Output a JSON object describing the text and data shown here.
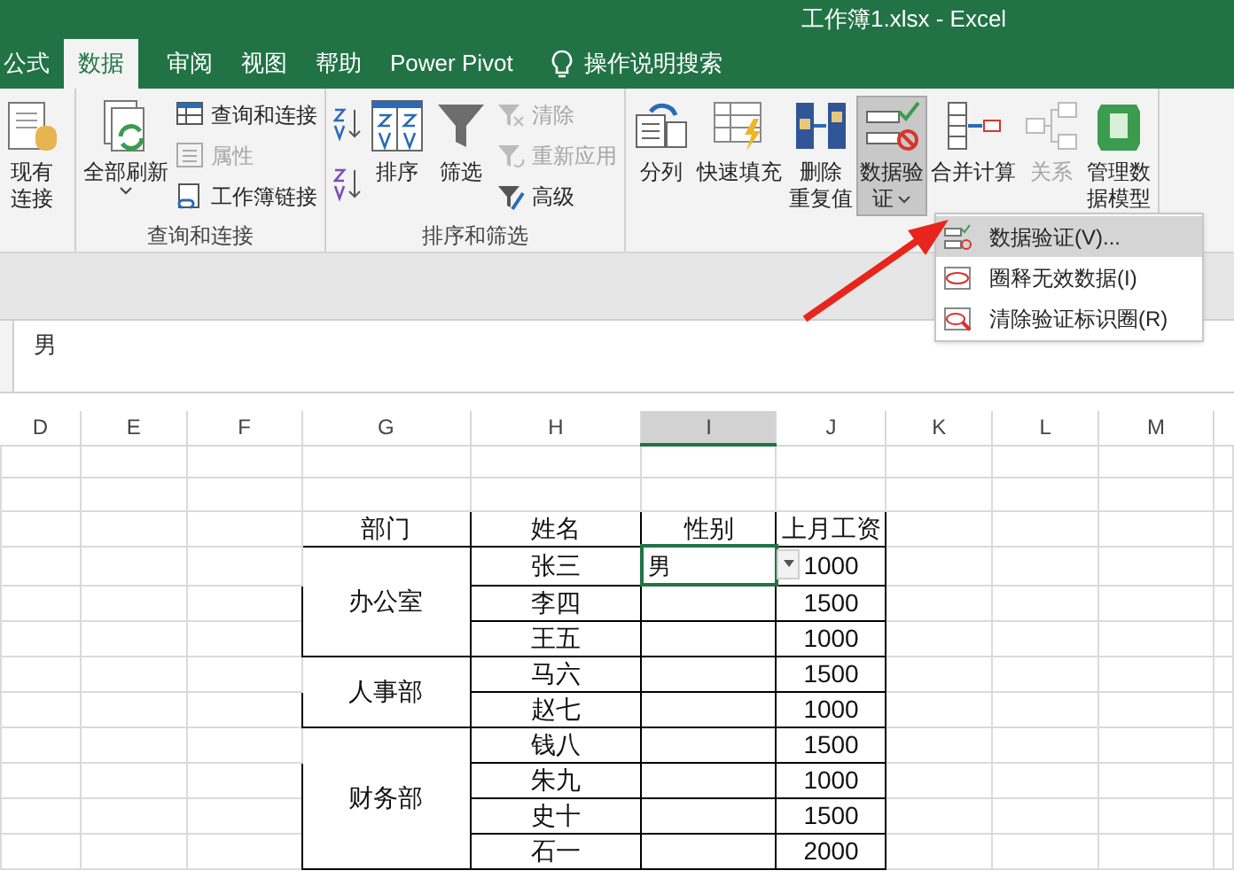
{
  "window": {
    "title": "工作簿1.xlsx  -  Excel"
  },
  "tabs": [
    {
      "label": "公式",
      "selected": false
    },
    {
      "label": "数据",
      "selected": true
    },
    {
      "label": "审阅",
      "selected": false
    },
    {
      "label": "视图",
      "selected": false
    },
    {
      "label": "帮助",
      "selected": false
    },
    {
      "label": "Power Pivot",
      "selected": false
    }
  ],
  "tell_me": "操作说明搜索",
  "ribbon": {
    "groups": [
      {
        "buttons": [
          {
            "kind": "large",
            "lines": [
              "现有",
              "连接"
            ],
            "disabled": false,
            "selected": false,
            "dropdown": false
          }
        ]
      },
      {
        "label": "查询和连接",
        "buttons": [
          {
            "kind": "large",
            "lines": [
              "全部刷新"
            ],
            "disabled": false,
            "selected": false,
            "dropdown": true
          },
          {
            "kind": "small",
            "lines": [
              "查询和连接"
            ],
            "disabled": false,
            "selected": false,
            "dropdown": false
          },
          {
            "kind": "small",
            "lines": [
              "属性"
            ],
            "disabled": true,
            "selected": false,
            "dropdown": false
          },
          {
            "kind": "small",
            "lines": [
              "工作簿链接"
            ],
            "disabled": false,
            "selected": false,
            "dropdown": false
          }
        ]
      },
      {
        "label": "排序和筛选",
        "buttons": [
          {
            "kind": "sort"
          },
          {
            "kind": "large",
            "lines": [
              "排序"
            ],
            "disabled": false,
            "selected": false,
            "dropdown": false
          },
          {
            "kind": "large",
            "lines": [
              "筛选"
            ],
            "disabled": false,
            "selected": false,
            "dropdown": false
          },
          {
            "kind": "small",
            "lines": [
              "清除"
            ],
            "disabled": true,
            "selected": false,
            "dropdown": false
          },
          {
            "kind": "small",
            "lines": [
              "重新应用"
            ],
            "disabled": true,
            "selected": false,
            "dropdown": false
          },
          {
            "kind": "small",
            "lines": [
              "高级"
            ],
            "disabled": false,
            "selected": false,
            "dropdown": false
          }
        ]
      },
      {
        "buttons": [
          {
            "kind": "large",
            "lines": [
              "分列"
            ],
            "disabled": false,
            "selected": false,
            "dropdown": false
          },
          {
            "kind": "large",
            "lines": [
              "快速填充"
            ],
            "disabled": false,
            "selected": false,
            "dropdown": false
          },
          {
            "kind": "large",
            "lines": [
              "删除",
              "重复值"
            ],
            "disabled": false,
            "selected": false,
            "dropdown": false
          },
          {
            "kind": "large",
            "lines": [
              "数据验",
              "证"
            ],
            "disabled": false,
            "selected": true,
            "dropdown": true
          },
          {
            "kind": "large",
            "lines": [
              "合并计算"
            ],
            "disabled": false,
            "selected": false,
            "dropdown": false
          },
          {
            "kind": "large",
            "lines": [
              "关系"
            ],
            "disabled": true,
            "selected": false,
            "dropdown": false
          },
          {
            "kind": "large",
            "lines": [
              "管理数",
              "据模型"
            ],
            "disabled": false,
            "selected": false,
            "dropdown": false
          }
        ]
      }
    ]
  },
  "menu": [
    {
      "label": "数据验证(V)...",
      "selected": true
    },
    {
      "label": "圈释无效数据(I)",
      "selected": false
    },
    {
      "label": "清除验证标识圈(R)",
      "selected": false
    }
  ],
  "formula_bar": {
    "value": "男"
  },
  "column_headers": [
    {
      "label": "D",
      "selected": false
    },
    {
      "label": "E",
      "selected": false
    },
    {
      "label": "F",
      "selected": false
    },
    {
      "label": "G",
      "selected": false
    },
    {
      "label": "H",
      "selected": false
    },
    {
      "label": "I",
      "selected": true
    },
    {
      "label": "J",
      "selected": false
    },
    {
      "label": "K",
      "selected": false
    },
    {
      "label": "L",
      "selected": false
    },
    {
      "label": "M",
      "selected": false
    }
  ],
  "table": {
    "columns": [
      "部门",
      "姓名",
      "性别",
      "上月工资"
    ],
    "groups": [
      {
        "department": "办公室",
        "rows": [
          {
            "name": "张三",
            "gender": "男",
            "salary": "1000",
            "active": true
          },
          {
            "name": "李四",
            "salary": "1500",
            "active": false
          },
          {
            "name": "王五",
            "salary": "1000",
            "active": false
          }
        ]
      },
      {
        "department": "人事部",
        "rows": [
          {
            "name": "马六",
            "salary": "1500",
            "active": false
          },
          {
            "name": "赵七",
            "salary": "1000",
            "active": false
          }
        ]
      },
      {
        "department": "财务部",
        "rows": [
          {
            "name": "钱八",
            "salary": "1500",
            "active": false
          },
          {
            "name": "朱九",
            "salary": "1000",
            "active": false
          },
          {
            "name": "史十",
            "salary": "1500",
            "active": false
          },
          {
            "name": "石一",
            "salary": "2000",
            "active": false
          }
        ]
      }
    ]
  }
}
